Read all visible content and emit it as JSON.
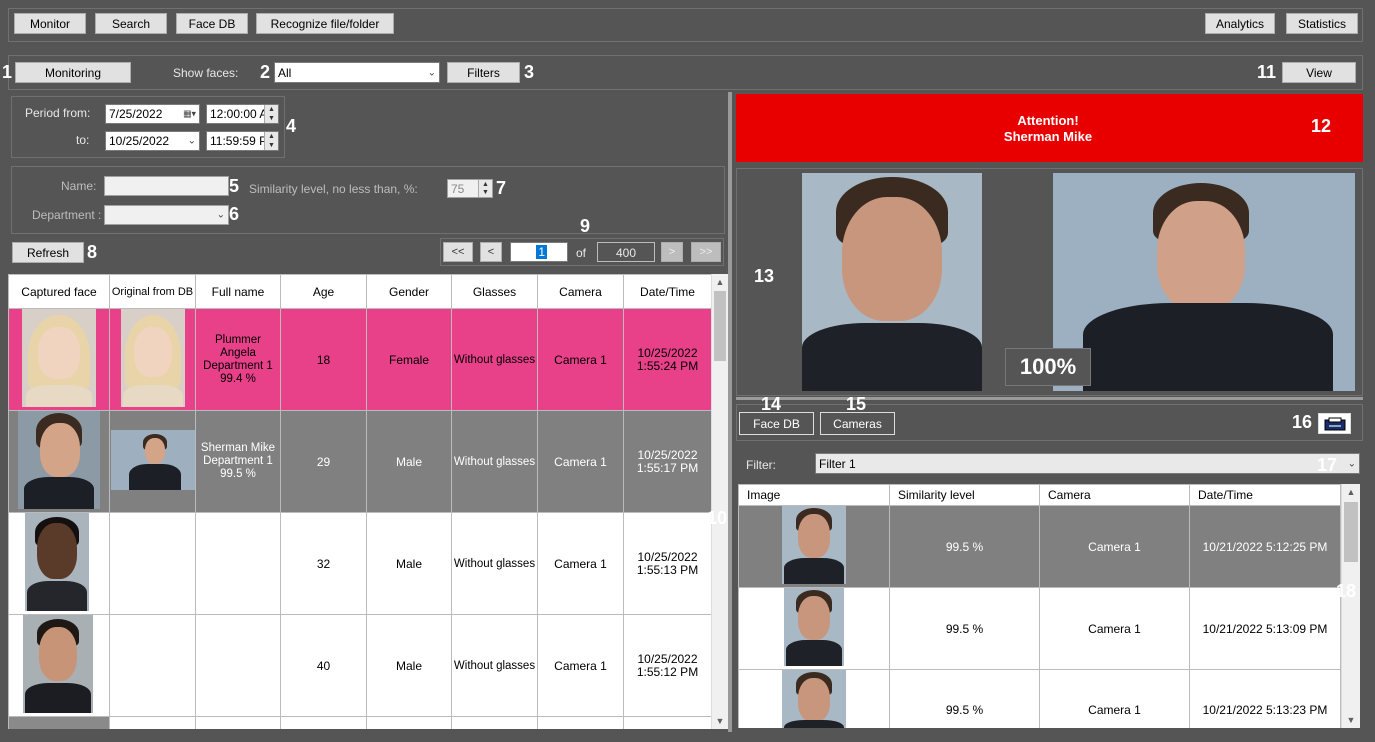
{
  "toolbar": {
    "monitor": "Monitor",
    "search": "Search",
    "face_db": "Face DB",
    "recognize": "Recognize file/folder",
    "analytics": "Analytics",
    "statistics": "Statistics"
  },
  "controls": {
    "monitoring": "Monitoring",
    "show_faces_label": "Show faces:",
    "show_faces_value": "All",
    "filters": "Filters",
    "view": "View"
  },
  "period": {
    "from_label": "Period from:",
    "to_label": "to:",
    "from_date": "7/25/2022",
    "from_time": "12:00:00 A",
    "to_date": "10/25/2022",
    "to_time": "11:59:59 P"
  },
  "search": {
    "name_label": "Name:",
    "name_value": "",
    "department_label": "Department :",
    "department_value": "",
    "similarity_label": "Similarity level, no less than, %:",
    "similarity_value": "75",
    "refresh": "Refresh"
  },
  "pager": {
    "first": "<<",
    "prev": "<",
    "page": "1",
    "of": "of",
    "total": "400",
    "next": ">",
    "last": ">>"
  },
  "callouts": [
    "1",
    "2",
    "3",
    "4",
    "5",
    "6",
    "7",
    "8",
    "9",
    "10",
    "11",
    "12",
    "13",
    "14",
    "15",
    "16",
    "17",
    "18"
  ],
  "results": {
    "columns": [
      "Captured face",
      "Original from DB",
      "Full name",
      "Age",
      "Gender",
      "Glasses",
      "Camera",
      "Date/Time"
    ],
    "rows": [
      {
        "full_name": "Plummer Angela\nDepartment 1\n99.4 %",
        "age": "18",
        "gender": "Female",
        "glasses": "Without glasses",
        "camera": "Camera 1",
        "datetime": "10/25/2022\n1:55:24 PM",
        "style": "pink"
      },
      {
        "full_name": "Sherman Mike\nDepartment 1\n99.5 %",
        "age": "29",
        "gender": "Male",
        "glasses": "Without glasses",
        "camera": "Camera 1",
        "datetime": "10/25/2022\n1:55:17 PM",
        "style": "gray"
      },
      {
        "full_name": "",
        "age": "32",
        "gender": "Male",
        "glasses": "Without glasses",
        "camera": "Camera 1",
        "datetime": "10/25/2022\n1:55:13 PM",
        "style": "white"
      },
      {
        "full_name": "",
        "age": "40",
        "gender": "Male",
        "glasses": "Without glasses",
        "camera": "Camera 1",
        "datetime": "10/25/2022\n1:55:12 PM",
        "style": "white"
      }
    ]
  },
  "alert": {
    "line1": "Attention!",
    "line2": "Sherman Mike",
    "color": "#e80000"
  },
  "compare": {
    "similarity": "100%"
  },
  "right_panel": {
    "face_db": "Face DB",
    "cameras": "Cameras",
    "filter_label": "Filter:",
    "filter_value": "Filter 1",
    "columns": [
      "Image",
      "Similarity level",
      "Camera",
      "Date/Time"
    ],
    "rows": [
      {
        "similarity": "99.5 %",
        "camera": "Camera 1",
        "datetime": "10/21/2022 5:12:25 PM",
        "style": "gray"
      },
      {
        "similarity": "99.5 %",
        "camera": "Camera 1",
        "datetime": "10/21/2022 5:13:09 PM",
        "style": "white"
      },
      {
        "similarity": "99.5 %",
        "camera": "Camera 1",
        "datetime": "10/21/2022 5:13:23 PM",
        "style": "white"
      }
    ]
  },
  "colors": {
    "background": "#555555",
    "pink_row": "#e8418a",
    "gray_row": "#808080",
    "alert": "#e80000"
  }
}
